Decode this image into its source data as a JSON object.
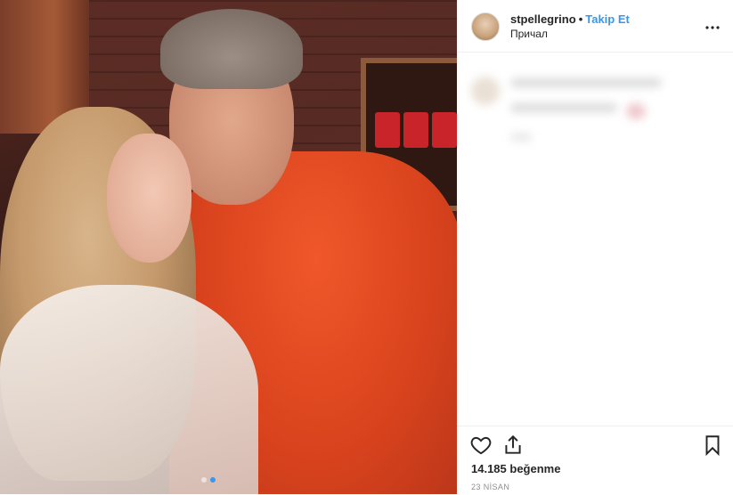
{
  "post": {
    "image_alt": "Photo",
    "carousel": {
      "count": 2,
      "active_index": 1
    }
  },
  "header": {
    "username": "stpellegrino",
    "separator": "•",
    "follow_label": "Takip Et",
    "location": "Причал",
    "more_icon": "more-horizontal-icon"
  },
  "actions": {
    "like_icon": "heart-icon",
    "share_icon": "share-icon",
    "save_icon": "bookmark-icon",
    "likes_text": "14.185 beğenme",
    "date_text": "23 NİSAN"
  },
  "colors": {
    "link": "#3897f0",
    "text": "#262626",
    "muted": "#8e8e8e",
    "border": "#efefef"
  }
}
